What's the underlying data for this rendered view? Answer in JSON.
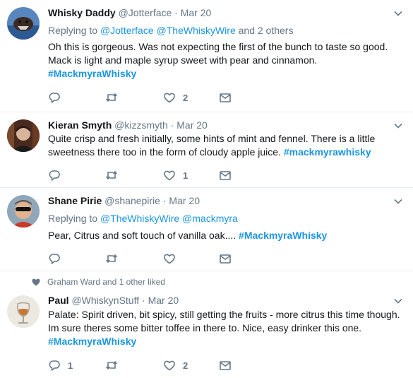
{
  "colors": {
    "link": "#1b95e0",
    "secondary": "#657786",
    "text": "#14171a",
    "divider": "#e6ecf0"
  },
  "tweets": [
    {
      "name": "Whisky Daddy",
      "handle": "@Jotterface",
      "separator": "·",
      "date": "Mar 20",
      "replying_prefix": "Replying to",
      "replying_to": [
        "@Jotterface",
        "@TheWhiskyWire"
      ],
      "replying_suffix": "and 2 others",
      "text_lines": [
        "Oh this is gorgeous. Was not expecting the first of the bunch to taste so good.",
        "Mack is light and maple syrup sweet with pear and cinnamon."
      ],
      "hashtag": "#MackmyraWhisky",
      "reply_count": "",
      "like_count": "2"
    },
    {
      "name": "Kieran Smyth",
      "handle": "@kizzsmyth",
      "separator": "·",
      "date": "Mar 20",
      "text_lines": [
        "Quite crisp and fresh initially, some hints of mint and fennel. There is a little",
        "sweetness there too in the form of cloudy apple juice."
      ],
      "hashtag": "#mackmyrawhisky",
      "reply_count": "",
      "like_count": "1"
    },
    {
      "name": "Shane Pirie",
      "handle": "@shanepirie",
      "separator": "·",
      "date": "Mar 20",
      "replying_prefix": "Replying to",
      "replying_to": [
        "@TheWhiskyWire",
        "@mackmyra"
      ],
      "text": "Pear, Citrus and soft touch of vanilla oak....",
      "hashtag": "#MackmyraWhisky",
      "reply_count": "",
      "like_count": ""
    },
    {
      "social_context": "Graham Ward and 1 other liked",
      "name": "Paul",
      "handle": "@WhiskynStuff",
      "separator": "·",
      "date": "Mar 20",
      "text_lines": [
        "Palate: Spirit driven, bit spicy, still getting the fruits - more citrus this time though.",
        "Im sure theres some bitter toffee in there to. Nice, easy drinker this one."
      ],
      "hashtag": "#MackmyraWhisky",
      "reply_count": "1",
      "like_count": "2"
    }
  ],
  "icons": {
    "reply": "reply-icon",
    "retweet": "retweet-icon",
    "like": "heart-icon",
    "dm": "envelope-icon",
    "caret": "chevron-down-icon",
    "social": "heart-icon"
  }
}
